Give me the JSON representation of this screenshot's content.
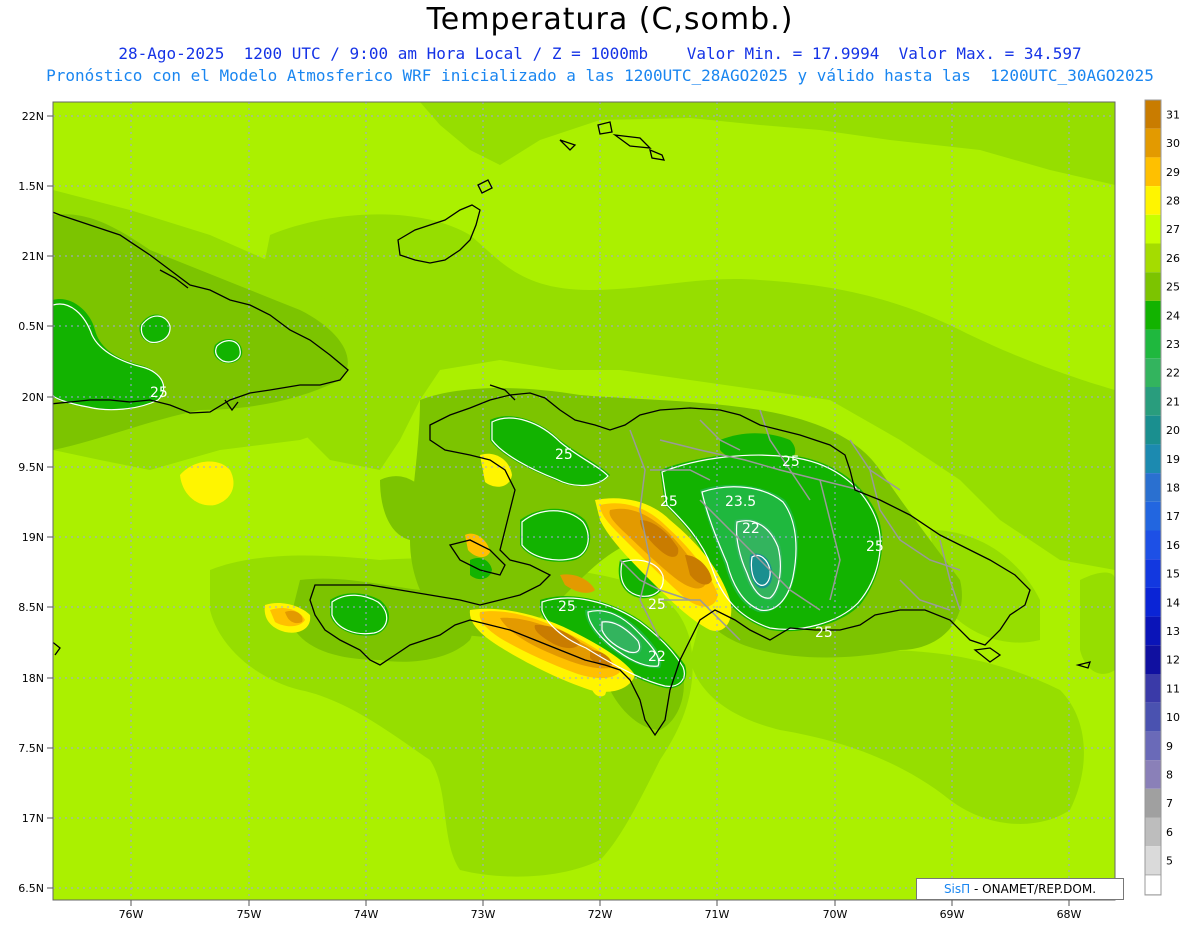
{
  "header": {
    "title": "Temperatura (C,somb.)",
    "line1": "28-Ago-2025  1200 UTC / 9:00 am Hora Local / Z = 1000mb    Valor Min. = 17.9994  Valor Max. = 34.597",
    "line2": "Pronóstico con el Modelo Atmosferico WRF inicializado a las 1200UTC_28AGO2025 y válido hasta las  1200UTC_30AGO2025"
  },
  "map": {
    "lon_labels": [
      "76W",
      "75W",
      "74W",
      "73W",
      "72W",
      "71W",
      "70W",
      "69W",
      "68W"
    ],
    "lat_labels": [
      "22N",
      "1.5N",
      "21N",
      "0.5N",
      "20N",
      "9.5N",
      "19N",
      "8.5N",
      "18N",
      "7.5N",
      "17N",
      "6.5N"
    ],
    "contour_labels": [
      "25",
      "25",
      "25",
      "25",
      "23.5",
      "22",
      "25",
      "25",
      "25",
      "22"
    ]
  },
  "colorbar": {
    "levels": [
      "31",
      "30",
      "29",
      "28",
      "27",
      "26",
      "25",
      "24",
      "23",
      "22",
      "21",
      "20",
      "19",
      "18",
      "17",
      "16",
      "15",
      "14",
      "13",
      "12",
      "11",
      "10",
      "9",
      "8",
      "7",
      "6",
      "5"
    ],
    "colors": [
      "#c97c00",
      "#e39a00",
      "#ffc000",
      "#fff500",
      "#c8ff00",
      "#a5dc00",
      "#7cc400",
      "#12b300",
      "#1fb83e",
      "#33b45e",
      "#299d7d",
      "#1a8f8f",
      "#1c8ab0",
      "#2a70d0",
      "#2266e0",
      "#1d50e6",
      "#1238e0",
      "#0a24d6",
      "#0a14b8",
      "#1010a0",
      "#3a3aa8",
      "#4a52b0",
      "#6a6ab8",
      "#8a80b8",
      "#a0a0a0",
      "#bdbdbd",
      "#dadada"
    ]
  },
  "credit": {
    "brand": "SisΠ",
    "text": "- ONAMET/REP.DOM."
  }
}
